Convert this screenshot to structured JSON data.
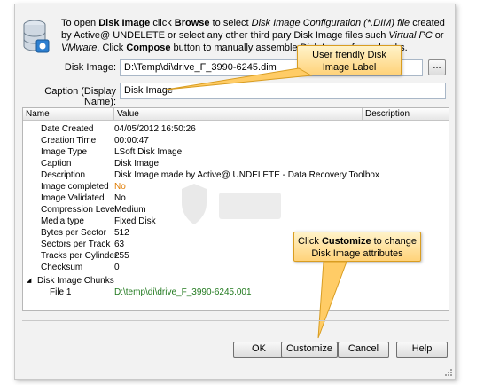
{
  "intro": {
    "p1": "To open ",
    "b1": "Disk Image",
    "p2": " click ",
    "b2": "Browse",
    "p3": " to select ",
    "i1": "Disk Image Configuration (*.DIM) file",
    "p4": " created by Active@ UNDELETE or select any other third pary Disk Image files such ",
    "i2": "Virtual PC",
    "p5": " or ",
    "i3": "VMware",
    "p6": ". Click ",
    "b3": "Compose",
    "p7": " button to manually assemble Disk Image from chunks."
  },
  "disk_image": {
    "label": "Disk Image:",
    "value": "D:\\Temp\\di\\drive_F_3990-6245.dim",
    "browse_label": "..."
  },
  "caption": {
    "label": "Caption (Display Name):",
    "value": "Disk Image"
  },
  "callouts": {
    "label_hint": "User frendly Disk Image Label",
    "customize_pre": "Click ",
    "customize_bold": "Customize",
    "customize_post": " to change Disk Image attributes"
  },
  "grid": {
    "columns": {
      "name": "Name",
      "value": "Value",
      "description": "Description"
    },
    "rows": [
      {
        "name": "Date Created",
        "value": "04/05/2012 16:50:26"
      },
      {
        "name": "Creation Time",
        "value": "00:00:47"
      },
      {
        "name": "Image Type",
        "value": "LSoft Disk Image"
      },
      {
        "name": "Caption",
        "value": "Disk Image"
      },
      {
        "name": "Description",
        "value": "Disk Image made by Active@ UNDELETE - Data Recovery Toolbox"
      },
      {
        "name": "Image completed",
        "value": "No"
      },
      {
        "name": "Image Validated",
        "value": "No"
      },
      {
        "name": "Compression Level",
        "value": "Medium"
      },
      {
        "name": "Media type",
        "value": "Fixed Disk"
      },
      {
        "name": "Bytes per Sector",
        "value": "512"
      },
      {
        "name": "Sectors per Track",
        "value": "63"
      },
      {
        "name": "Tracks per Cylinder",
        "value": "255"
      },
      {
        "name": "Checksum",
        "value": "0"
      }
    ],
    "group": {
      "toggle": "◢",
      "name": "Disk Image Chunks"
    },
    "file": {
      "name": "File 1",
      "value": "D:\\temp\\di\\drive_F_3990-6245.001"
    }
  },
  "buttons": {
    "ok": "OK",
    "customize": "Customize",
    "cancel": "Cancel",
    "help": "Help"
  },
  "colors": {
    "callout_fill": "#ffd37a",
    "callout_border": "#d99d21",
    "orange_value": "#e07b00",
    "green_value": "#227a1f"
  }
}
